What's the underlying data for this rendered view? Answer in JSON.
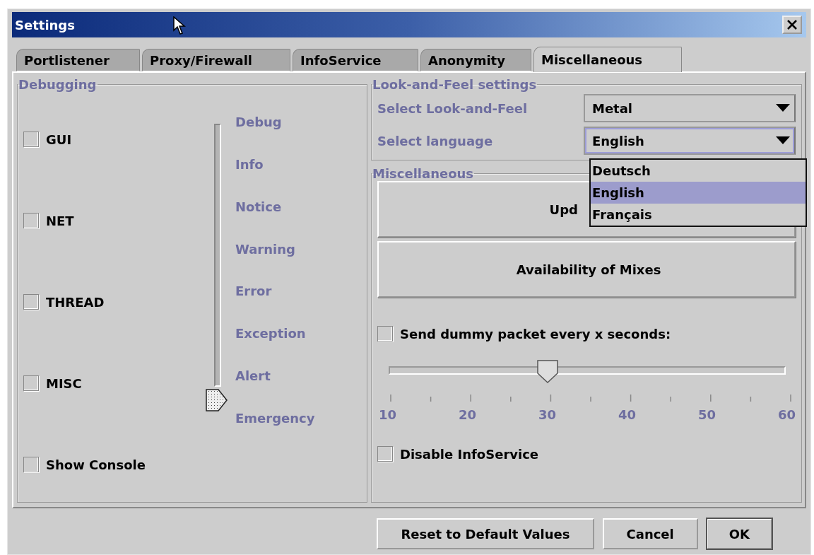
{
  "window": {
    "title": "Settings"
  },
  "tabs": [
    {
      "label": "Portlistener",
      "selected": false
    },
    {
      "label": "Proxy/Firewall",
      "selected": false
    },
    {
      "label": "InfoService",
      "selected": false
    },
    {
      "label": "Anonymity",
      "selected": false
    },
    {
      "label": "Miscellaneous",
      "selected": true
    }
  ],
  "debugging": {
    "title": "Debugging",
    "checkboxes": [
      {
        "label": "GUI",
        "checked": false
      },
      {
        "label": "NET",
        "checked": false
      },
      {
        "label": "THREAD",
        "checked": false
      },
      {
        "label": "MISC",
        "checked": false
      },
      {
        "label": "Show Console",
        "checked": false
      }
    ],
    "level_slider": {
      "level": 1,
      "labels": [
        "Debug",
        "Info",
        "Notice",
        "Warning",
        "Error",
        "Exception",
        "Alert",
        "Emergency"
      ]
    }
  },
  "look_and_feel": {
    "title": "Look-and-Feel settings",
    "rows": [
      {
        "label": "Select Look-and-Feel",
        "value": "Metal",
        "focused": false
      },
      {
        "label": "Select language",
        "value": "English",
        "focused": true
      }
    ],
    "open_list": [
      {
        "label": "Deutsch",
        "selected": false
      },
      {
        "label": "English",
        "selected": true
      },
      {
        "label": "Français",
        "selected": false
      }
    ]
  },
  "miscellaneous": {
    "title": "Miscellaneous",
    "buttons": [
      "Upd",
      "Availability of Mixes"
    ],
    "dummy_packet": {
      "label": "Send dummy packet every x seconds:",
      "checked": false
    },
    "interval_slider": {
      "level": 0.4,
      "tick_labels": [
        "10",
        "20",
        "30",
        "40",
        "50",
        "60"
      ]
    },
    "disable_infoservice": {
      "label": "Disable InfoService",
      "checked": false
    }
  },
  "footer_buttons": [
    {
      "label": "Reset to Default Values",
      "default": false
    },
    {
      "label": "Cancel",
      "default": false
    },
    {
      "label": "OK",
      "default": true
    }
  ]
}
